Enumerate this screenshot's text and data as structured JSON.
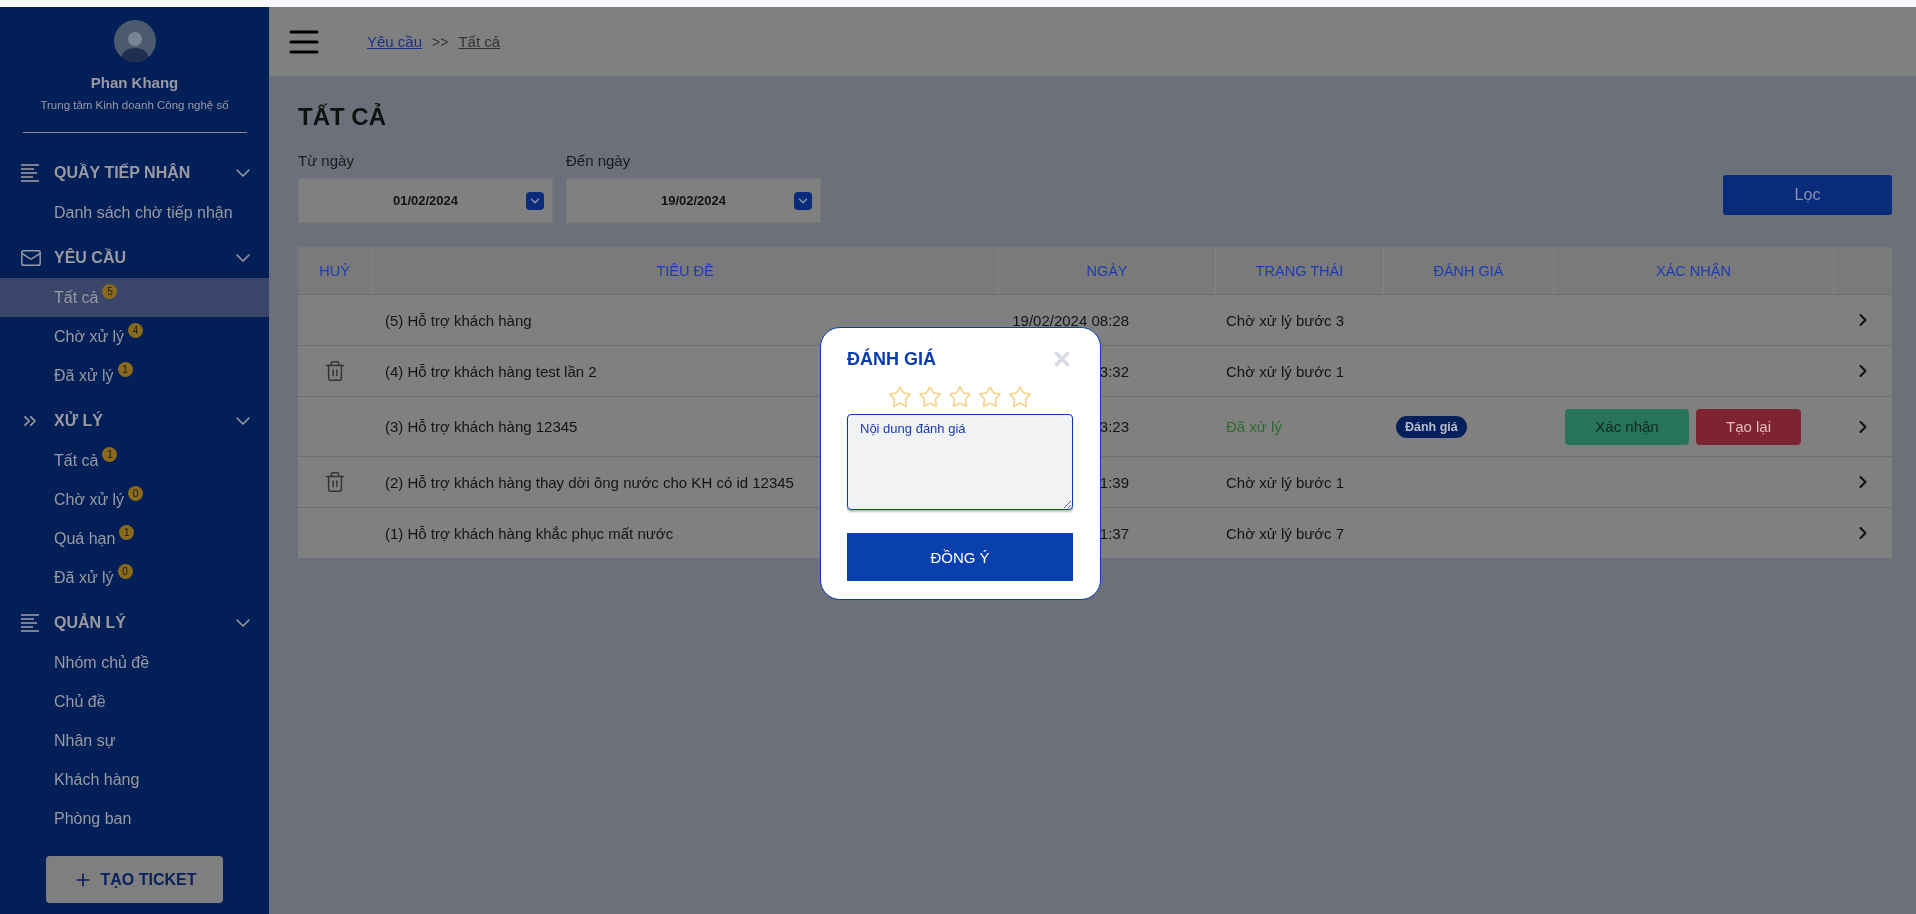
{
  "sidebar": {
    "user": {
      "name": "Phan Khang",
      "department": "Trung tâm Kinh doanh Công nghệ số"
    },
    "sections": [
      {
        "kind": "lines",
        "title": "QUẦY TIẾP NHẬN",
        "expanded": true,
        "items": [
          {
            "label": "Danh sách chờ tiếp nhận",
            "selected": false
          }
        ]
      },
      {
        "kind": "mail",
        "title": "YÊU CẦU",
        "expanded": true,
        "items": [
          {
            "label": "Tất cả",
            "badge": "5",
            "selected": true
          },
          {
            "label": "Chờ xử lý",
            "badge": "4",
            "selected": false
          },
          {
            "label": "Đã xử lý",
            "badge": "1",
            "selected": false
          }
        ]
      },
      {
        "kind": "chevrons",
        "title": "XỬ LÝ",
        "expanded": true,
        "items": [
          {
            "label": "Tất cả",
            "badge": "1",
            "selected": false
          },
          {
            "label": "Chờ xử lý",
            "badge": "0",
            "selected": false
          },
          {
            "label": "Quá hạn",
            "badge": "1",
            "selected": false
          },
          {
            "label": "Đã xử lý",
            "badge": "0",
            "selected": false
          }
        ]
      },
      {
        "kind": "lines",
        "title": "QUẢN LÝ",
        "expanded": true,
        "items": [
          {
            "label": "Nhóm chủ đề",
            "selected": false
          },
          {
            "label": "Chủ đề",
            "selected": false
          },
          {
            "label": "Nhân sự",
            "selected": false
          },
          {
            "label": "Khách hàng",
            "selected": false
          },
          {
            "label": "Phòng ban",
            "selected": false
          }
        ]
      }
    ],
    "create_button": "TẠO TICKET"
  },
  "breadcrumb": {
    "separator": ">>",
    "items": [
      {
        "label": "Yêu cầu",
        "current": false
      },
      {
        "label": "Tất cả",
        "current": true
      }
    ]
  },
  "page_title": "TẤT CẢ",
  "filters": [
    {
      "label": "Từ ngày",
      "value": "01/02/2024"
    },
    {
      "label": "Đến ngày",
      "value": "19/02/2024"
    }
  ],
  "filter_button": "Lọc",
  "table": {
    "columns": [
      "HUỶ",
      "TIÊU ĐỀ",
      "NGÀY",
      "TRẠNG THÁI",
      "ĐÁNH GIÁ",
      "XÁC NHẬN"
    ],
    "rows": [
      {
        "deletable": false,
        "title": "(5) Hỗ trợ khách hàng",
        "date": "19/02/2024 08:28",
        "status": "Chờ xử lý bước 3",
        "done": false
      },
      {
        "deletable": true,
        "title": "(4) Hỗ trợ khách hàng test lần 2",
        "date": "3:32",
        "status": "Chờ xử lý bước 1",
        "done": false
      },
      {
        "deletable": false,
        "title": "(3) Hỗ trợ khách hàng 12345",
        "date": "3:23",
        "status": "Đã xử lý",
        "done": true,
        "rating": "Đánh giá",
        "actions": [
          {
            "label": "Xác nhận",
            "kind": "confirm"
          },
          {
            "label": "Tạo lại",
            "kind": "redo"
          }
        ]
      },
      {
        "deletable": true,
        "title": "(2) Hỗ trợ khách hàng thay dời ông nước cho KH có id 12345",
        "date": "1:39",
        "status": "Chờ xử lý bước 1",
        "done": false
      },
      {
        "deletable": false,
        "title": "(1) Hỗ trợ khách hàng khắc phục mất nước",
        "date": "1:37",
        "status": "Chờ xử lý bước 7",
        "done": false
      }
    ]
  },
  "modal": {
    "title": "ĐÁNH GIÁ",
    "stars": 0,
    "placeholder": "Nội dung đánh giá",
    "submit": "ĐỒNG Ý"
  }
}
